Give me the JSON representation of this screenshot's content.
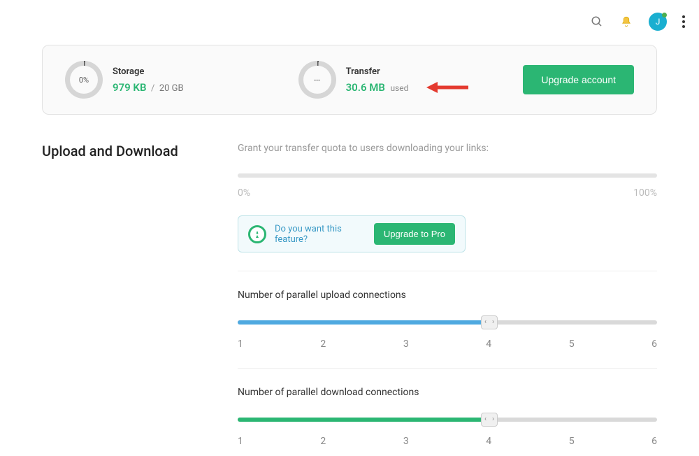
{
  "topbar": {
    "avatar_initial": "J"
  },
  "card": {
    "storage": {
      "title": "Storage",
      "percent": "0%",
      "value": "979 KB",
      "sep": "/",
      "limit": "20 GB"
    },
    "transfer": {
      "title": "Transfer",
      "percent": "---",
      "value": "30.6 MB",
      "used_label": "used"
    },
    "upgrade_label": "Upgrade account"
  },
  "section_heading": "Upload and Download",
  "quota": {
    "label": "Grant your transfer quota to users downloading your links:",
    "min": "0%",
    "max": "100%"
  },
  "feature": {
    "text": "Do you want this feature?",
    "button_label": "Upgrade to Pro"
  },
  "upload_section": {
    "title": "Number of parallel upload connections",
    "ticks": [
      "1",
      "2",
      "3",
      "4",
      "5",
      "6"
    ]
  },
  "download_section": {
    "title": "Number of parallel download connections",
    "ticks": [
      "1",
      "2",
      "3",
      "4",
      "5",
      "6"
    ]
  }
}
